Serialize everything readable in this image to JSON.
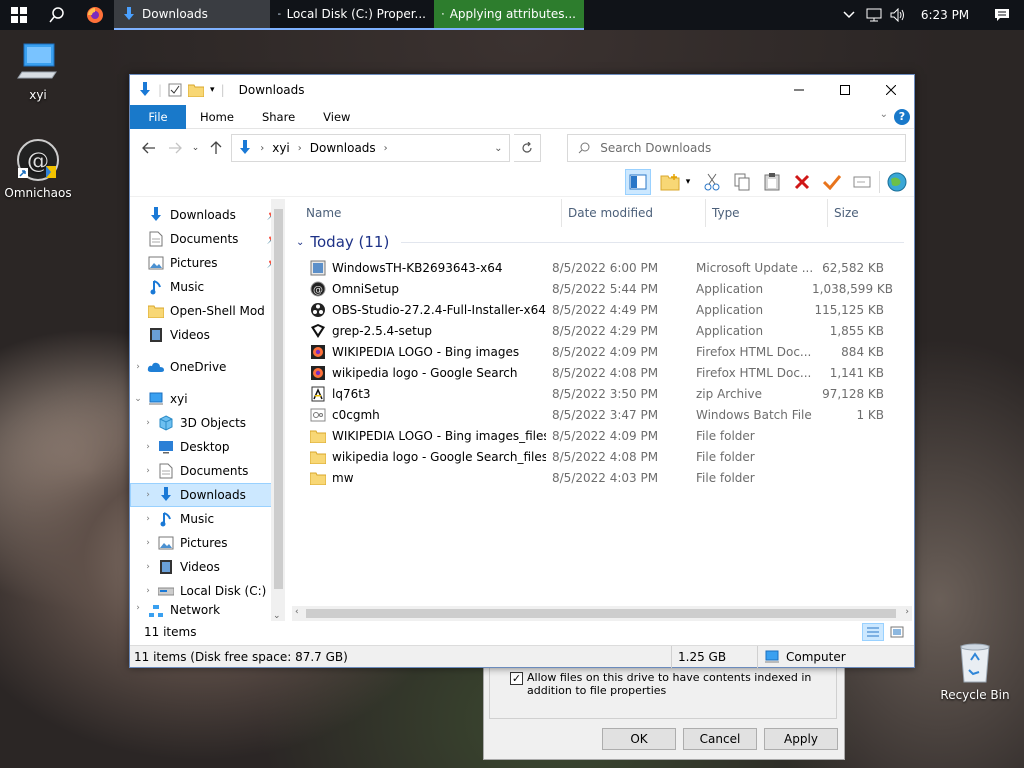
{
  "taskbar": {
    "tasks": [
      {
        "label": "Downloads"
      },
      {
        "label": "Local Disk (C:) Proper..."
      },
      {
        "label": "Applying attributes..."
      }
    ],
    "clock": "6:23 PM"
  },
  "desktop": {
    "icons": [
      {
        "label": "xyi"
      },
      {
        "label": "Omnichaos"
      },
      {
        "label": "Recycle Bin"
      }
    ]
  },
  "properties_dialog": {
    "index_checkbox_label": "Allow files on this drive to have contents indexed in addition to file properties",
    "ok": "OK",
    "cancel": "Cancel",
    "apply": "Apply"
  },
  "window": {
    "title": "Downloads",
    "ribbon_tabs": [
      "File",
      "Home",
      "Share",
      "View"
    ],
    "address": {
      "segments": [
        "xyi",
        "Downloads"
      ]
    },
    "search_placeholder": "Search Downloads"
  },
  "nav_pane": {
    "quick_access": [
      {
        "label": "Downloads",
        "icon": "download-arrow-icon",
        "pinned": true
      },
      {
        "label": "Documents",
        "icon": "documents-icon",
        "pinned": true
      },
      {
        "label": "Pictures",
        "icon": "pictures-icon",
        "pinned": true
      },
      {
        "label": "Music",
        "icon": "music-icon",
        "pinned": false
      },
      {
        "label": "Open-Shell Mod",
        "icon": "folder-icon",
        "pinned": false
      },
      {
        "label": "Videos",
        "icon": "videos-icon",
        "pinned": false
      }
    ],
    "onedrive": "OneDrive",
    "this_pc": "xyi",
    "this_pc_children": [
      {
        "label": "3D Objects"
      },
      {
        "label": "Desktop"
      },
      {
        "label": "Documents"
      },
      {
        "label": "Downloads"
      },
      {
        "label": "Music"
      },
      {
        "label": "Pictures"
      },
      {
        "label": "Videos"
      },
      {
        "label": "Local Disk (C:)"
      }
    ],
    "network": "Network"
  },
  "file_list": {
    "columns": [
      "Name",
      "Date modified",
      "Type",
      "Size"
    ],
    "group_label": "Today (11)",
    "rows": [
      {
        "name": "WindowsTH-KB2693643-x64",
        "date": "8/5/2022 6:00 PM",
        "type": "Microsoft Update ...",
        "size": "62,582 KB",
        "icon": "msu"
      },
      {
        "name": "OmniSetup",
        "date": "8/5/2022 5:44 PM",
        "type": "Application",
        "size": "1,038,599 KB",
        "icon": "omni"
      },
      {
        "name": "OBS-Studio-27.2.4-Full-Installer-x64",
        "date": "8/5/2022 4:49 PM",
        "type": "Application",
        "size": "115,125 KB",
        "icon": "obs"
      },
      {
        "name": "grep-2.5.4-setup",
        "date": "8/5/2022 4:29 PM",
        "type": "Application",
        "size": "1,855 KB",
        "icon": "grep"
      },
      {
        "name": "WIKIPEDIA LOGO - Bing images",
        "date": "8/5/2022 4:09 PM",
        "type": "Firefox HTML Doc...",
        "size": "884 KB",
        "icon": "html"
      },
      {
        "name": "wikipedia logo - Google Search",
        "date": "8/5/2022 4:08 PM",
        "type": "Firefox HTML Doc...",
        "size": "1,141 KB",
        "icon": "html"
      },
      {
        "name": "lq76t3",
        "date": "8/5/2022 3:50 PM",
        "type": "zip Archive",
        "size": "97,128 KB",
        "icon": "zip"
      },
      {
        "name": "c0cgmh",
        "date": "8/5/2022 3:47 PM",
        "type": "Windows Batch File",
        "size": "1 KB",
        "icon": "bat"
      },
      {
        "name": "WIKIPEDIA LOGO - Bing images_files",
        "date": "8/5/2022 4:09 PM",
        "type": "File folder",
        "size": "",
        "icon": "folder"
      },
      {
        "name": "wikipedia logo - Google Search_files",
        "date": "8/5/2022 4:08 PM",
        "type": "File folder",
        "size": "",
        "icon": "folder"
      },
      {
        "name": "mw",
        "date": "8/5/2022 4:03 PM",
        "type": "File folder",
        "size": "",
        "icon": "folder"
      }
    ]
  },
  "status": {
    "item_count": "11 items",
    "disk_free": "11 items (Disk free space: 87.7 GB)",
    "size": "1.25 GB",
    "location": "Computer"
  },
  "colors": {
    "accent": "#1979ca",
    "selection": "#cce8ff",
    "group_header": "#1e3287"
  }
}
